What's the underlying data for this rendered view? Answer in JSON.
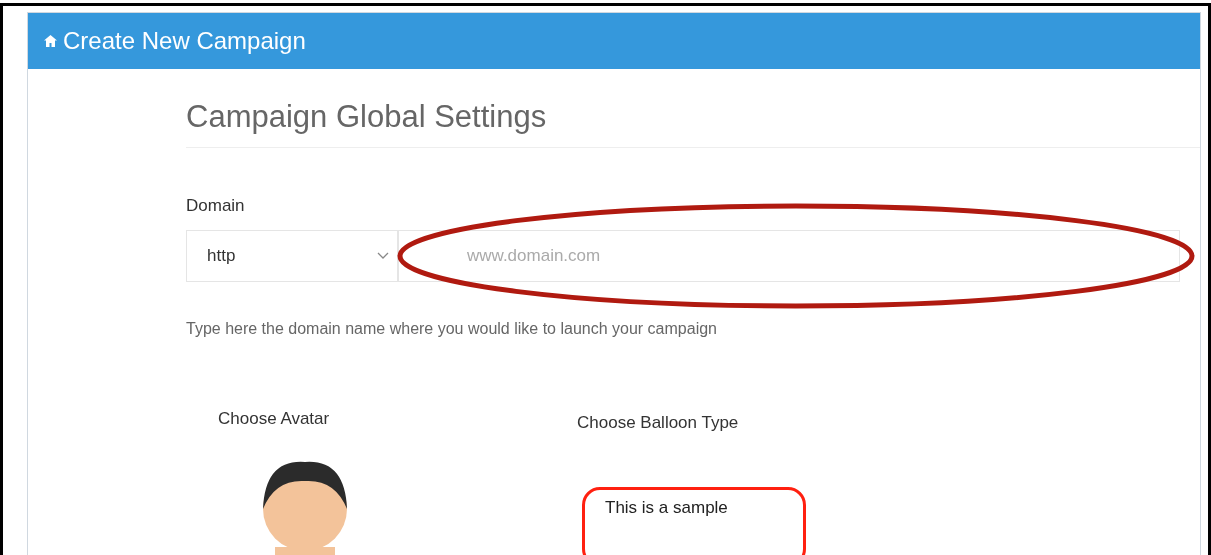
{
  "header": {
    "title": "Create New Campaign"
  },
  "section": {
    "title": "Campaign Global Settings"
  },
  "domain": {
    "label": "Domain",
    "protocol": "http",
    "placeholder": "www.domain.com",
    "help": "Type here the domain name where you would like to launch your campaign"
  },
  "avatar": {
    "label": "Choose Avatar"
  },
  "balloon": {
    "label": "Choose Balloon Type",
    "sample": "This is a sample"
  }
}
